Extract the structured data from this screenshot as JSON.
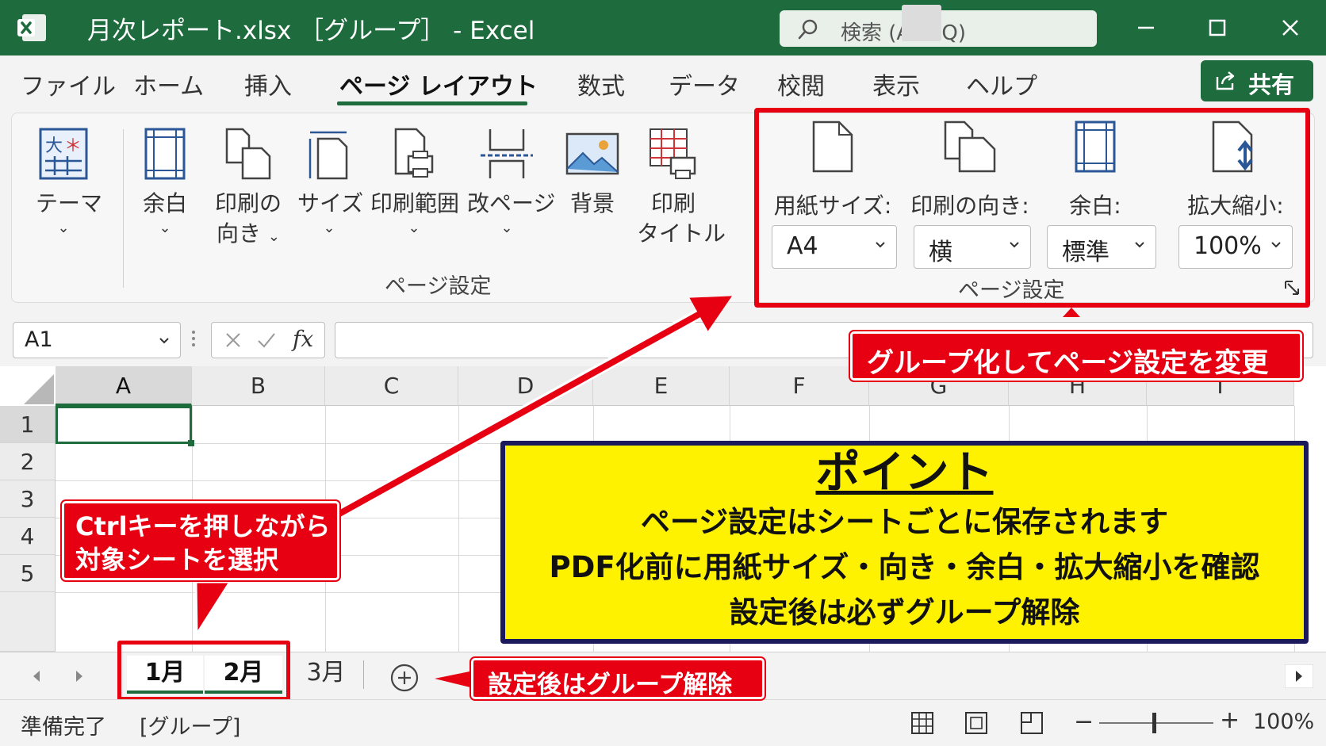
{
  "titlebar": {
    "title": "月次レポート.xlsx ［グループ］ -  Excel",
    "search_placeholder": "検索 (Alt+Q)"
  },
  "menu": {
    "tabs": [
      "ファイル",
      "ホーム",
      "挿入",
      "ページ レイアウト",
      "数式",
      "データ",
      "校閲",
      "表示",
      "ヘルプ"
    ],
    "active_tab": "ページ レイアウト",
    "share_label": "共有"
  },
  "ribbon": {
    "theme": "テーマ",
    "margins": "余白",
    "orientation_l1": "印刷の",
    "orientation_l2": "向き",
    "size": "サイズ",
    "print_area": "印刷範囲",
    "breaks": "改ページ",
    "background": "背景",
    "print_titles_l1": "印刷",
    "print_titles_l2": "タイトル",
    "group_label": "ページ設定"
  },
  "quick_page_setup": {
    "paper_size_label": "用紙サイズ:",
    "paper_size_value": "A4",
    "orientation_label": "印刷の向き:",
    "orientation_value": "横",
    "margins_label": "余白:",
    "margins_value": "標準",
    "scale_label": "拡大縮小:",
    "scale_value": "100%",
    "group_label": "ページ設定"
  },
  "formula_bar": {
    "name_box": "A1",
    "fx": "fx",
    "formula": ""
  },
  "grid": {
    "columns": [
      "A",
      "B",
      "C",
      "D",
      "E",
      "F",
      "G",
      "H",
      "I"
    ],
    "rows": [
      "1",
      "2",
      "3",
      "4",
      "5"
    ],
    "active_cell": "A1"
  },
  "sheet_tabs": [
    {
      "label": "1月",
      "selected": true
    },
    {
      "label": "2月",
      "selected": true
    },
    {
      "label": "3月",
      "selected": false
    }
  ],
  "status": {
    "ready": "準備完了",
    "group": "[グループ]",
    "zoom": "100%"
  },
  "callouts": {
    "group_change": "グループ化してページ設定を変更",
    "ctrl_line1": "Ctrlキーを押しながら",
    "ctrl_line2": "対象シートを選択",
    "release": "設定後はグループ解除"
  },
  "point": {
    "title": "ポイント",
    "line1": "ページ設定はシートごとに保存されます",
    "line2": "PDF化前に用紙サイズ・向き・余白・拡大縮小を確認",
    "line3": "設定後は必ずグループ解除"
  },
  "colors": {
    "excel_green": "#1e6b3e",
    "callout_red": "#e60012",
    "point_yellow": "#fff200",
    "point_border": "#1a1a5c"
  }
}
